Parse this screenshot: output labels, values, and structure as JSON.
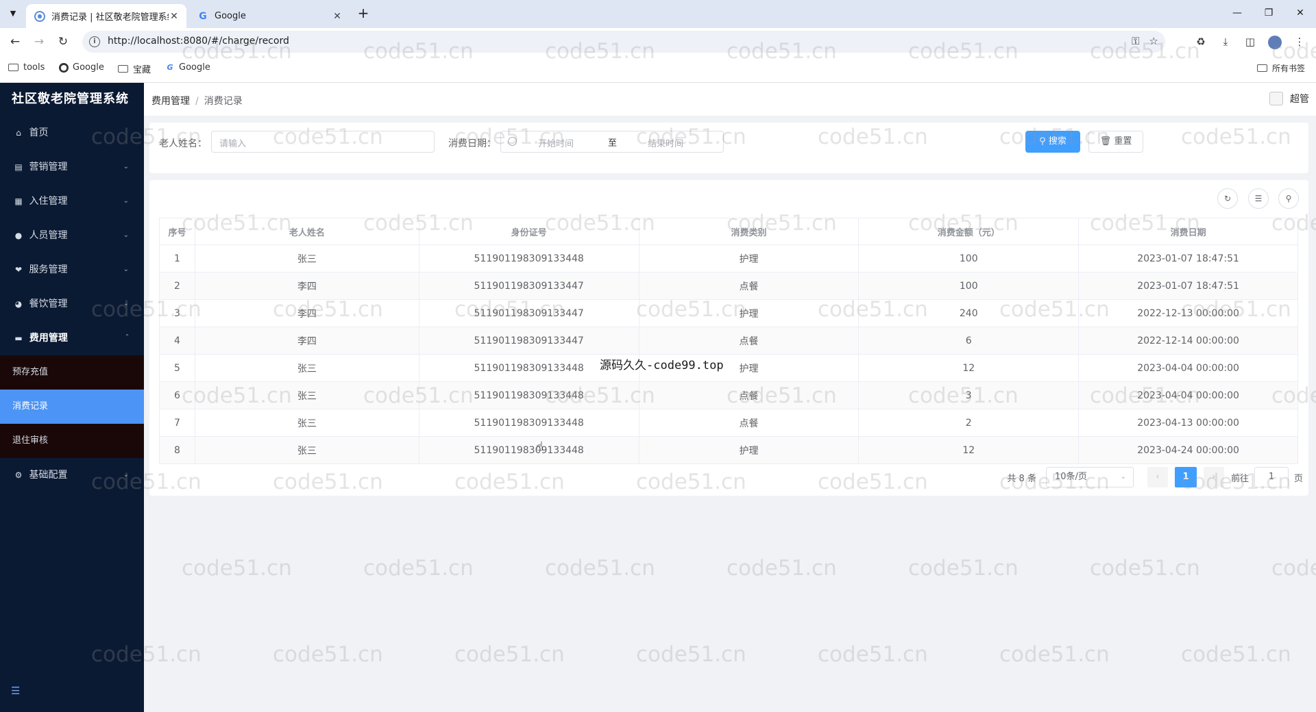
{
  "browser": {
    "tabs": [
      {
        "title": "消费记录 | 社区敬老院管理系统",
        "active": true
      },
      {
        "title": "Google",
        "active": false
      }
    ],
    "url": "http://localhost:8080/#/charge/record",
    "bookmarks": [
      "tools",
      "Google",
      "宝藏",
      "Google"
    ],
    "bookmarks_all": "所有书签",
    "window_controls": [
      "minimize-icon",
      "restore-icon",
      "close-icon"
    ]
  },
  "sidebar": {
    "logo": "社区敬老院管理系统",
    "items": [
      {
        "label": "首页",
        "icon": "home-icon"
      },
      {
        "label": "营销管理",
        "icon": "chart-icon"
      },
      {
        "label": "入住管理",
        "icon": "building-icon"
      },
      {
        "label": "人员管理",
        "icon": "user-icon"
      },
      {
        "label": "服务管理",
        "icon": "heart-icon"
      },
      {
        "label": "餐饮管理",
        "icon": "bowl-icon"
      },
      {
        "label": "费用管理",
        "icon": "money-icon"
      },
      {
        "label": "基础配置",
        "icon": "gear-icon"
      }
    ],
    "subitems": [
      "预存充值",
      "消费记录",
      "退住审核"
    ]
  },
  "header": {
    "breadcrumb": [
      "费用管理",
      "消费记录"
    ],
    "user": "超管"
  },
  "search": {
    "name_label": "老人姓名：",
    "name_placeholder": "请输入",
    "date_label": "消费日期：",
    "start_placeholder": "开始时间",
    "range_sep": "至",
    "end_placeholder": "结束时间",
    "search_button": "搜索",
    "reset_button": "重置"
  },
  "table": {
    "columns": [
      "序号",
      "老人姓名",
      "身份证号",
      "消费类别",
      "消费金额（元）",
      "消费日期"
    ],
    "rows": [
      [
        "1",
        "张三",
        "511901198309133448",
        "护理",
        "100",
        "2023-01-07 18:47:51"
      ],
      [
        "2",
        "李四",
        "511901198309133447",
        "点餐",
        "100",
        "2023-01-07 18:47:51"
      ],
      [
        "3",
        "李四",
        "511901198309133447",
        "护理",
        "240",
        "2022-12-13 00:00:00"
      ],
      [
        "4",
        "李四",
        "511901198309133447",
        "点餐",
        "6",
        "2022-12-14 00:00:00"
      ],
      [
        "5",
        "张三",
        "511901198309133448",
        "护理",
        "12",
        "2023-04-04 00:00:00"
      ],
      [
        "6",
        "张三",
        "511901198309133448",
        "点餐",
        "3",
        "2023-04-04 00:00:00"
      ],
      [
        "7",
        "张三",
        "511901198309133448",
        "点餐",
        "2",
        "2023-04-13 00:00:00"
      ],
      [
        "8",
        "张三",
        "511901198309133448",
        "护理",
        "12",
        "2023-04-24 00:00:00"
      ]
    ]
  },
  "pagination": {
    "total": "共 8 条",
    "page_size": "10条/页",
    "current_page": "1",
    "goto_label": "前往",
    "goto_value": "1",
    "goto_suffix": "页"
  },
  "watermark": {
    "text": "code51.cn",
    "center_text": "源码久久-code99.top"
  }
}
